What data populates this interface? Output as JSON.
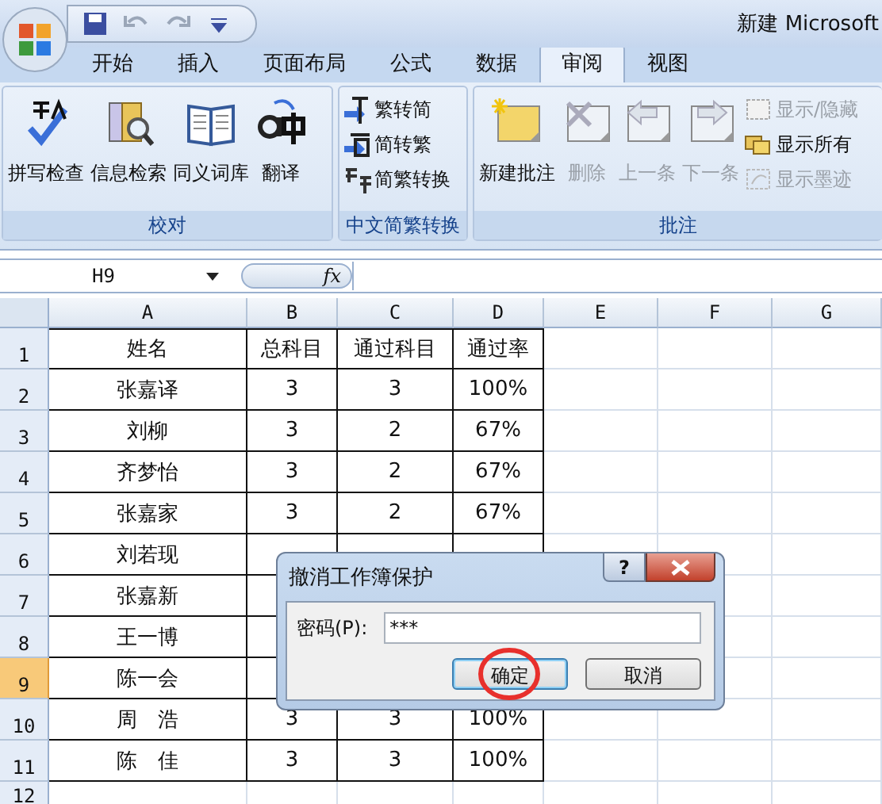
{
  "window": {
    "title": "新建 Microsoft"
  },
  "quick_access": [
    {
      "kind": "save",
      "disabled": false
    },
    {
      "kind": "undo",
      "disabled": true
    },
    {
      "kind": "redo",
      "disabled": true
    },
    {
      "kind": "customize",
      "disabled": false
    }
  ],
  "tabs": [
    {
      "label": "开始",
      "selected": false
    },
    {
      "label": "插入",
      "selected": false
    },
    {
      "label": "页面布局",
      "selected": false
    },
    {
      "label": "公式",
      "selected": false
    },
    {
      "label": "数据",
      "selected": false
    },
    {
      "label": "审阅",
      "selected": true
    },
    {
      "label": "视图",
      "selected": false
    }
  ],
  "ribbon_groups": [
    {
      "title": "校对",
      "items": [
        {
          "kind": "large",
          "label": "拼写检查",
          "disabled": false
        },
        {
          "kind": "large",
          "label": "信息检索",
          "disabled": false
        },
        {
          "kind": "large",
          "label": "同义词库",
          "disabled": false
        },
        {
          "kind": "large",
          "label": "翻译",
          "disabled": false
        }
      ]
    },
    {
      "title": "中文简繁转换",
      "items": [
        {
          "kind": "small",
          "label": "繁转简",
          "disabled": false
        },
        {
          "kind": "small",
          "label": "简转繁",
          "disabled": false
        },
        {
          "kind": "small",
          "label": "简繁转换",
          "disabled": false
        }
      ]
    },
    {
      "title": "批注",
      "items": [
        {
          "kind": "large",
          "label": "新建批注",
          "disabled": false
        },
        {
          "kind": "large",
          "label": "删除",
          "disabled": true
        },
        {
          "kind": "large",
          "label": "上一条",
          "disabled": true
        },
        {
          "kind": "large",
          "label": "下一条",
          "disabled": true
        },
        {
          "kind": "small",
          "label": "显示/隐藏",
          "disabled": true
        },
        {
          "kind": "small",
          "label": "显示所有",
          "disabled": false
        },
        {
          "kind": "small",
          "label": "显示墨迹",
          "disabled": true
        }
      ]
    }
  ],
  "formula_bar": {
    "name_box": "H9",
    "function_label": "fx"
  },
  "sheet": {
    "columns": [
      "A",
      "B",
      "C",
      "D",
      "E",
      "F",
      "G"
    ],
    "rows": [
      {
        "header": "1",
        "selected": false,
        "cells": [
          "姓名",
          "总科目",
          "通过科目",
          "通过率"
        ]
      },
      {
        "header": "2",
        "selected": false,
        "cells": [
          "张嘉译",
          "3",
          "3",
          "100%"
        ]
      },
      {
        "header": "3",
        "selected": false,
        "cells": [
          "刘柳",
          "3",
          "2",
          "67%"
        ]
      },
      {
        "header": "4",
        "selected": false,
        "cells": [
          "齐梦怡",
          "3",
          "2",
          "67%"
        ]
      },
      {
        "header": "5",
        "selected": false,
        "cells": [
          "张嘉家",
          "3",
          "2",
          "67%"
        ]
      },
      {
        "header": "6",
        "selected": false,
        "cells": [
          "刘若现"
        ]
      },
      {
        "header": "7",
        "selected": false,
        "cells": [
          "张嘉新"
        ]
      },
      {
        "header": "8",
        "selected": false,
        "cells": [
          "王一博"
        ]
      },
      {
        "header": "9",
        "selected": true,
        "cells": [
          "陈一会"
        ]
      },
      {
        "header": "10",
        "selected": false,
        "cells": [
          "周　浩",
          "3",
          "3",
          "100%"
        ]
      },
      {
        "header": "11",
        "selected": false,
        "cells": [
          "陈　佳",
          "3",
          "3",
          "100%"
        ]
      },
      {
        "header": "12",
        "selected": false,
        "cells": []
      }
    ]
  },
  "dialog": {
    "title": "撤消工作簿保护",
    "help": "?",
    "label": "密码(P):",
    "value": "***",
    "buttons": [
      {
        "label": "确定",
        "focused": true,
        "circled": true
      },
      {
        "label": "取消",
        "focused": false,
        "circled": false
      }
    ]
  }
}
